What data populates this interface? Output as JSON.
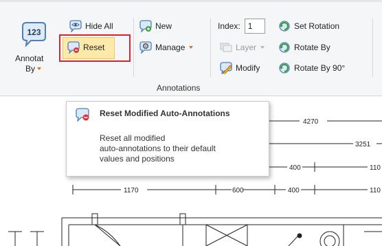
{
  "ribbon": {
    "annotate_button": {
      "icon_text": "123",
      "label_line1": "Annotat",
      "label_line2": "By"
    },
    "hide_all": {
      "label": "Hide All",
      "icon": "speech-bubble-eye-icon"
    },
    "reset": {
      "label": "Reset",
      "icon": "speech-bubble-reset-icon"
    },
    "new": {
      "label": "New",
      "icon": "speech-bubble-plus-icon"
    },
    "manage": {
      "label": "Manage",
      "icon": "gear-bubble-icon"
    },
    "index": {
      "label": "Index:",
      "value": "1"
    },
    "layer": {
      "label": "Layer",
      "icon": "layer-icon"
    },
    "modify": {
      "label": "Modify",
      "icon": "pencil-bubble-icon"
    },
    "set_rotation": {
      "label": "Set Rotation",
      "icon": "rotate-icon"
    },
    "rotate_by": {
      "label": "Rotate By",
      "icon": "rotate-icon"
    },
    "rotate_by_90": {
      "label": "Rotate By 90°",
      "icon": "rotate-90-icon"
    },
    "group_label": "Annotations",
    "colors": {
      "background": "#f5f6f7",
      "highlight": "#fde9a9",
      "callout_border": "#e3202a",
      "accent_orange": "#d4701c"
    }
  },
  "tooltip": {
    "title": "Reset Modified Auto-Annotations",
    "description_lines": [
      "Reset all modified",
      "auto-annotations to their default",
      "values and positions"
    ]
  },
  "drawing": {
    "dimensions": {
      "top_right": "4270",
      "row2_right": "3251",
      "row3_mid": "400",
      "row3_right": "110",
      "row4_left": "1170",
      "row4_mid1": "600",
      "row4_mid2": "400",
      "row4_right": "110"
    }
  }
}
